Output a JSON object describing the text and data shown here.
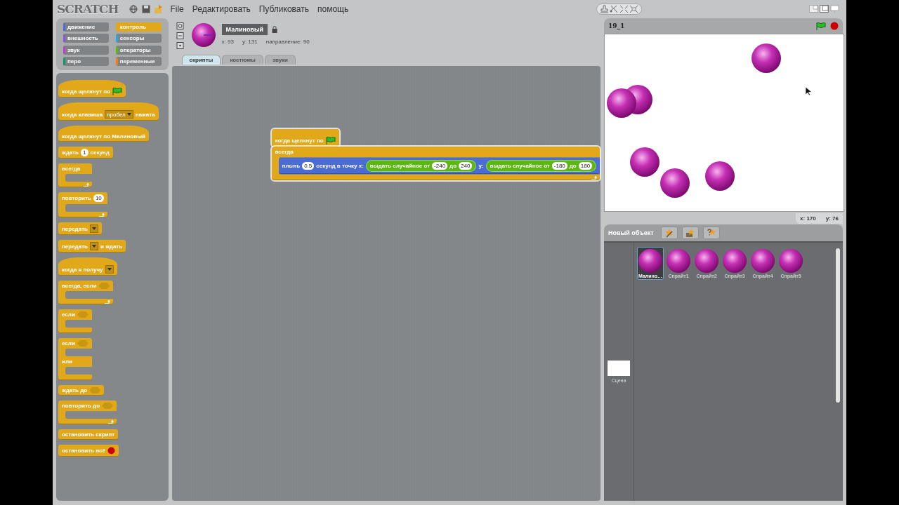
{
  "menu_bar": {
    "logo": "SCRATCH",
    "menus": [
      "File",
      "Редактировать",
      "Публиковать",
      "помощь"
    ]
  },
  "categories": [
    {
      "label": "движение",
      "color": "#4a6cd4",
      "selected": false
    },
    {
      "label": "контроль",
      "color": "#e1a91a",
      "selected": true
    },
    {
      "label": "внешность",
      "color": "#8a55d7",
      "selected": false
    },
    {
      "label": "сенсоры",
      "color": "#2ca5e2",
      "selected": false
    },
    {
      "label": "звук",
      "color": "#bb42c3",
      "selected": false
    },
    {
      "label": "операторы",
      "color": "#5cb712",
      "selected": false
    },
    {
      "label": "перо",
      "color": "#0e9a6c",
      "selected": false
    },
    {
      "label": "переменные",
      "color": "#ee7d16",
      "selected": false
    }
  ],
  "palette": [
    {
      "kind": "hat",
      "parts": [
        {
          "kind": "text",
          "text": "когда щелкнут по"
        },
        {
          "kind": "flag"
        }
      ]
    },
    {
      "kind": "hat",
      "parts": [
        {
          "kind": "text",
          "text": "когда клавиша"
        },
        {
          "kind": "dropdown",
          "text": "пробел"
        },
        {
          "kind": "text",
          "text": "нажата"
        }
      ]
    },
    {
      "kind": "hat",
      "parts": [
        {
          "kind": "text",
          "text": "когда щелкнут по Малиновый"
        }
      ]
    },
    {
      "kind": "stack",
      "parts": [
        {
          "kind": "text",
          "text": "ждать"
        },
        {
          "kind": "number",
          "text": "1"
        },
        {
          "kind": "text",
          "text": "секунд"
        }
      ]
    },
    {
      "kind": "c",
      "loop": true,
      "parts": [
        {
          "kind": "text",
          "text": "всегда"
        }
      ]
    },
    {
      "kind": "c",
      "loop": true,
      "parts": [
        {
          "kind": "text",
          "text": "повторить"
        },
        {
          "kind": "number",
          "text": "10"
        }
      ]
    },
    {
      "kind": "stack",
      "parts": [
        {
          "kind": "text",
          "text": "передать"
        },
        {
          "kind": "dropdown"
        }
      ]
    },
    {
      "kind": "stack",
      "parts": [
        {
          "kind": "text",
          "text": "передать"
        },
        {
          "kind": "dropdown"
        },
        {
          "kind": "text",
          "text": "и ждать"
        }
      ]
    },
    {
      "kind": "hat",
      "parts": [
        {
          "kind": "text",
          "text": "когда я получу"
        },
        {
          "kind": "dropdown"
        }
      ]
    },
    {
      "kind": "c",
      "loop": true,
      "parts": [
        {
          "kind": "text",
          "text": "всегда, если"
        },
        {
          "kind": "boolean"
        }
      ]
    },
    {
      "kind": "c",
      "loop": false,
      "parts": [
        {
          "kind": "text",
          "text": "если"
        },
        {
          "kind": "boolean"
        }
      ]
    },
    {
      "kind": "ifelse",
      "parts": [
        {
          "kind": "text",
          "text": "если"
        },
        {
          "kind": "boolean"
        }
      ],
      "else_parts": [
        {
          "kind": "text",
          "text": "или"
        }
      ]
    },
    {
      "kind": "stack",
      "parts": [
        {
          "kind": "text",
          "text": "ждать до"
        },
        {
          "kind": "boolean"
        }
      ]
    },
    {
      "kind": "c",
      "loop": true,
      "parts": [
        {
          "kind": "text",
          "text": "повторить до"
        },
        {
          "kind": "boolean"
        }
      ]
    },
    {
      "kind": "cap",
      "parts": [
        {
          "kind": "text",
          "text": "остановить скрипт"
        }
      ]
    },
    {
      "kind": "cap",
      "parts": [
        {
          "kind": "text",
          "text": "остановить всё"
        },
        {
          "kind": "stop"
        }
      ]
    }
  ],
  "sprite_info": {
    "name": "Малиновый",
    "x": "x: 93",
    "y": "y: 131",
    "direction": "направление: 90"
  },
  "tabs": [
    {
      "label": "скрипты",
      "selected": true
    },
    {
      "label": "костюмы",
      "selected": false
    },
    {
      "label": "звуки",
      "selected": false
    }
  ],
  "script": [
    {
      "kind": "hat",
      "color": "#e1a91a",
      "parts": [
        {
          "kind": "text",
          "text": "когда щелкнут по"
        },
        {
          "kind": "flag"
        }
      ]
    },
    {
      "kind": "c",
      "color": "#e1a91a",
      "loop": true,
      "parts": [
        {
          "kind": "text",
          "text": "всегда"
        }
      ],
      "children": [
        {
          "kind": "stack",
          "color": "#4a6cd4",
          "parts": [
            {
              "kind": "text",
              "text": "плыть"
            },
            {
              "kind": "number",
              "text": "0.5"
            },
            {
              "kind": "text",
              "text": "секунд в точку x:"
            },
            {
              "kind": "reporter",
              "color": "#5cb712",
              "parts": [
                {
                  "kind": "text",
                  "text": "выдать случайное от"
                },
                {
                  "kind": "number",
                  "text": "-240"
                },
                {
                  "kind": "text",
                  "text": "до"
                },
                {
                  "kind": "number",
                  "text": "240"
                }
              ]
            },
            {
              "kind": "text",
              "text": "y:"
            },
            {
              "kind": "reporter",
              "color": "#5cb712",
              "parts": [
                {
                  "kind": "text",
                  "text": "выдать случайное от"
                },
                {
                  "kind": "number",
                  "text": "-180"
                },
                {
                  "kind": "text",
                  "text": "до"
                },
                {
                  "kind": "number",
                  "text": "180"
                }
              ]
            }
          ]
        }
      ]
    }
  ],
  "stage": {
    "title": "19_1"
  },
  "mouse_position": {
    "x": "x: 170",
    "y": "y: 76"
  },
  "sprite_list": {
    "title": "Новый объект",
    "stage_label": "Сцена",
    "sprites": [
      {
        "name": "Малино…",
        "selected": true
      },
      {
        "name": "Спрайт1",
        "selected": false
      },
      {
        "name": "Спрайт2",
        "selected": false
      },
      {
        "name": "Спрайт3",
        "selected": false
      },
      {
        "name": "Спрайт4",
        "selected": false
      },
      {
        "name": "Спрайт5",
        "selected": false
      }
    ]
  }
}
